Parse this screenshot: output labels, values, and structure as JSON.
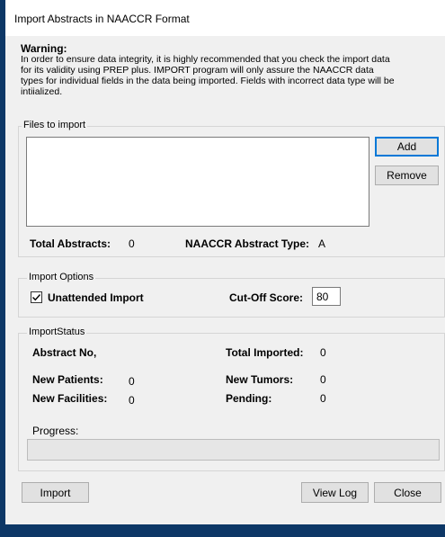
{
  "window": {
    "title": "Import Abstracts in NAACCR Format"
  },
  "warning": {
    "heading": "Warning:",
    "body": "In order to ensure data integrity, it is highly recommended that you check the import data for its validity using PREP plus.   IMPORT program will only assure the NAACCR data types for individual fields in the data being imported.  Fields with incorrect data type will be intiialized."
  },
  "files": {
    "legend": "Files to import",
    "add_label": "Add",
    "remove_label": "Remove",
    "total_label": "Total Abstracts:",
    "total_value": "0",
    "type_label": "NAACCR Abstract Type:",
    "type_value": "A"
  },
  "options": {
    "legend": "Import Options",
    "unattended_label": "Unattended Import",
    "unattended_checked": true,
    "cutoff_label": "Cut-Off Score:",
    "cutoff_value": "80"
  },
  "status": {
    "legend": "ImportStatus",
    "abstract_no_label": "Abstract No,",
    "total_imported_label": "Total Imported:",
    "total_imported_value": "0",
    "new_patients_label": "New Patients:",
    "new_patients_value": "0",
    "new_tumors_label": "New Tumors:",
    "new_tumors_value": "0",
    "new_facilities_label": "New Facilities:",
    "new_facilities_value": "0",
    "pending_label": "Pending:",
    "pending_value": "0",
    "progress_label": "Progress:",
    "progress_fraction": 0
  },
  "footer": {
    "import_label": "Import",
    "viewlog_label": "View Log",
    "close_label": "Close"
  }
}
